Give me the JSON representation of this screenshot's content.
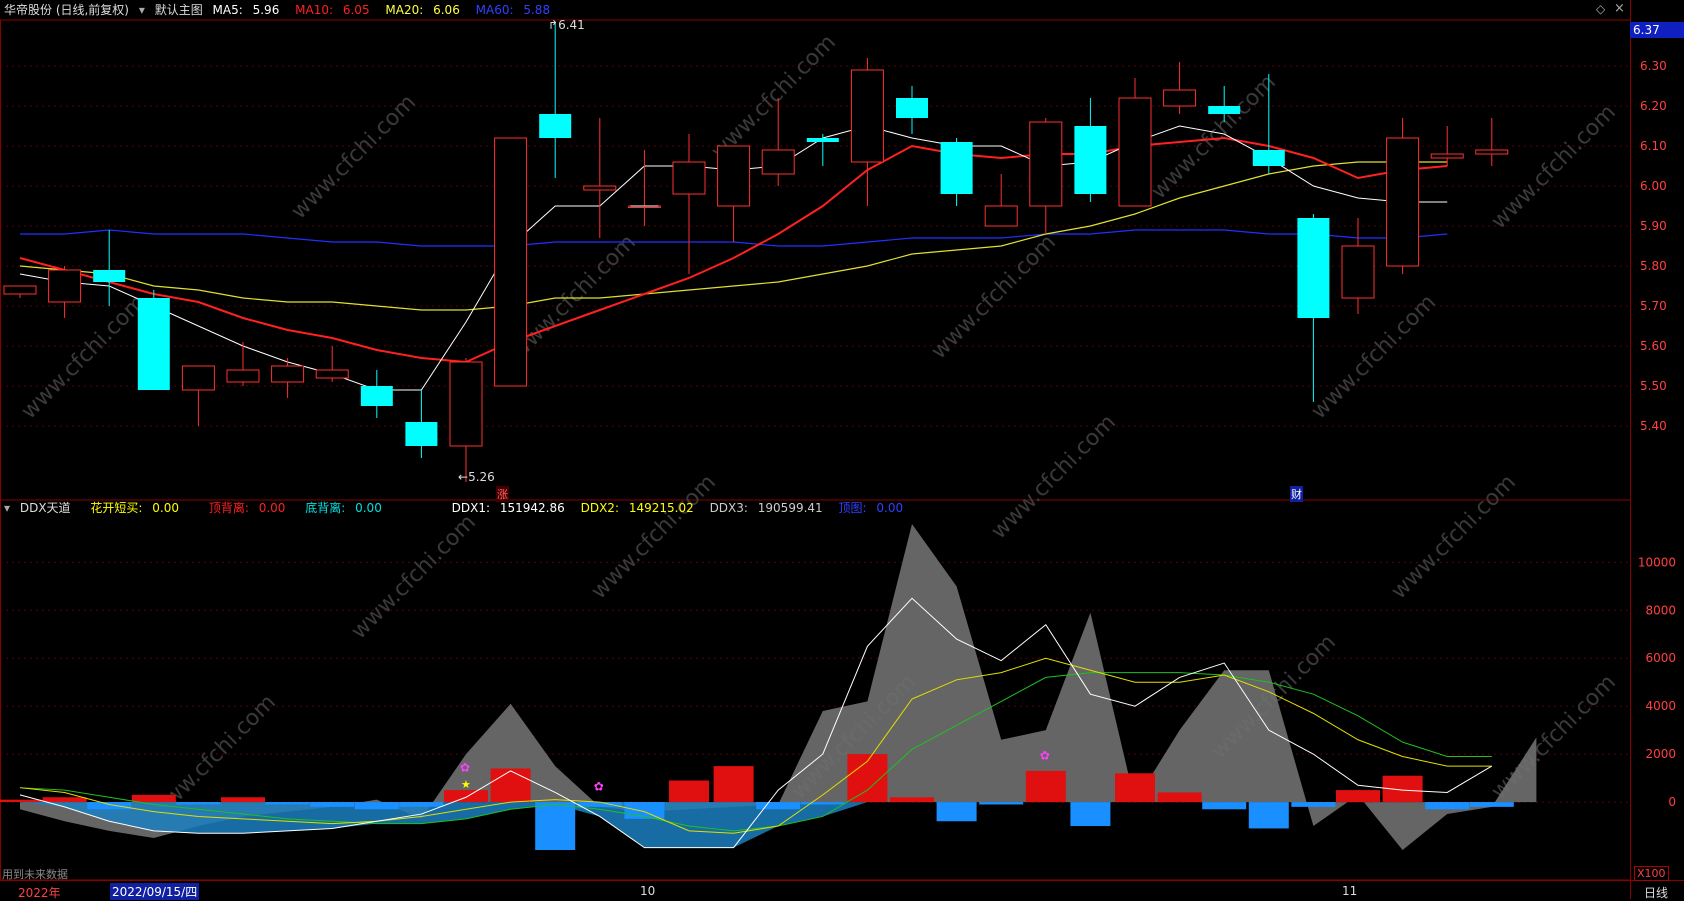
{
  "header": {
    "stock": "华帝股份 (日线,前复权)",
    "main_chart_label": "默认主图",
    "ma5": {
      "label": "MA5:",
      "value": "5.96",
      "color": "#ffffff"
    },
    "ma10": {
      "label": "MA10:",
      "value": "6.05",
      "color": "#ff2020"
    },
    "ma20": {
      "label": "MA20:",
      "value": "6.06",
      "color": "#ffff40"
    },
    "ma60": {
      "label": "MA60:",
      "value": "5.88",
      "color": "#2030ff"
    },
    "current_price": "6.37"
  },
  "sub_header": {
    "indicator": "DDX天道",
    "f1": {
      "label": "花开短买:",
      "value": "0.00",
      "color": "#ffff00"
    },
    "f2": {
      "label": "顶背离:",
      "value": "0.00",
      "color": "#ff2020"
    },
    "f3": {
      "label": "底背离:",
      "value": "0.00",
      "color": "#00ffff"
    },
    "ddx1": {
      "label": "DDX1:",
      "value": "151942.86",
      "color": "#ffffff"
    },
    "ddx2": {
      "label": "DDX2:",
      "value": "149215.02",
      "color": "#ffff00"
    },
    "ddx3": {
      "label": "DDX3:",
      "value": "190599.41",
      "color": "#cccccc"
    },
    "f7": {
      "label": "顶图:",
      "value": "0.00",
      "color": "#3040ff"
    }
  },
  "price_axis": [
    "6.30",
    "6.20",
    "6.10",
    "6.00",
    "5.90",
    "5.80",
    "5.70",
    "5.60",
    "5.50",
    "5.40"
  ],
  "ddx_axis": [
    "10000",
    "8000",
    "6000",
    "4000",
    "2000",
    "0"
  ],
  "annotations": {
    "high": "6.41",
    "low": "5.26",
    "tag_zhang": "涨",
    "tag_cai": "财",
    "x100": "X100",
    "future_data": "用到未来数据"
  },
  "time_axis": {
    "year": "2022年",
    "cursor_date": "2022/09/15/四",
    "m10": "10",
    "m11": "11",
    "period": "日线"
  },
  "watermark": "www.cfchi.com",
  "chart_data": {
    "type": "candlestick",
    "candles": [
      {
        "o": 5.73,
        "h": 5.75,
        "l": 5.72,
        "c": 5.75
      },
      {
        "o": 5.71,
        "h": 5.8,
        "l": 5.67,
        "c": 5.79
      },
      {
        "o": 5.79,
        "h": 5.89,
        "l": 5.7,
        "c": 5.76
      },
      {
        "o": 5.72,
        "h": 5.74,
        "l": 5.49,
        "c": 5.49
      },
      {
        "o": 5.49,
        "h": 5.55,
        "l": 5.4,
        "c": 5.55
      },
      {
        "o": 5.51,
        "h": 5.61,
        "l": 5.5,
        "c": 5.54
      },
      {
        "o": 5.51,
        "h": 5.57,
        "l": 5.47,
        "c": 5.55
      },
      {
        "o": 5.52,
        "h": 5.6,
        "l": 5.51,
        "c": 5.54
      },
      {
        "o": 5.5,
        "h": 5.54,
        "l": 5.42,
        "c": 5.45
      },
      {
        "o": 5.41,
        "h": 5.49,
        "l": 5.32,
        "c": 5.35
      },
      {
        "o": 5.35,
        "h": 5.57,
        "l": 5.26,
        "c": 5.56
      },
      {
        "o": 5.5,
        "h": 6.12,
        "l": 5.5,
        "c": 6.12
      },
      {
        "o": 6.18,
        "h": 6.41,
        "l": 6.02,
        "c": 6.12
      },
      {
        "o": 5.99,
        "h": 6.17,
        "l": 5.87,
        "c": 6.0
      },
      {
        "o": 5.95,
        "h": 6.09,
        "l": 5.9,
        "c": 5.95
      },
      {
        "o": 5.98,
        "h": 6.13,
        "l": 5.78,
        "c": 6.06
      },
      {
        "o": 5.95,
        "h": 6.1,
        "l": 5.86,
        "c": 6.1
      },
      {
        "o": 6.03,
        "h": 6.22,
        "l": 6.0,
        "c": 6.09
      },
      {
        "o": 6.12,
        "h": 6.13,
        "l": 6.05,
        "c": 6.11
      },
      {
        "o": 6.06,
        "h": 6.32,
        "l": 5.95,
        "c": 6.29
      },
      {
        "o": 6.22,
        "h": 6.25,
        "l": 6.13,
        "c": 6.17
      },
      {
        "o": 6.11,
        "h": 6.12,
        "l": 5.95,
        "c": 5.98
      },
      {
        "o": 5.9,
        "h": 6.03,
        "l": 5.9,
        "c": 5.95
      },
      {
        "o": 5.95,
        "h": 6.17,
        "l": 5.88,
        "c": 6.16
      },
      {
        "o": 6.15,
        "h": 6.22,
        "l": 5.96,
        "c": 5.98
      },
      {
        "o": 5.95,
        "h": 6.27,
        "l": 5.95,
        "c": 6.22
      },
      {
        "o": 6.2,
        "h": 6.31,
        "l": 6.18,
        "c": 6.24
      },
      {
        "o": 6.2,
        "h": 6.25,
        "l": 6.16,
        "c": 6.18
      },
      {
        "o": 6.09,
        "h": 6.28,
        "l": 6.03,
        "c": 6.05
      },
      {
        "o": 5.92,
        "h": 5.93,
        "l": 5.46,
        "c": 5.67
      },
      {
        "o": 5.72,
        "h": 5.92,
        "l": 5.68,
        "c": 5.85
      },
      {
        "o": 5.8,
        "h": 6.17,
        "l": 5.78,
        "c": 6.12
      },
      {
        "o": 6.07,
        "h": 6.15,
        "l": 6.05,
        "c": 6.08
      },
      {
        "o": 6.08,
        "h": 6.17,
        "l": 6.05,
        "c": 6.09
      }
    ],
    "ma5": [
      5.78,
      5.76,
      5.75,
      5.7,
      5.65,
      5.6,
      5.56,
      5.53,
      5.49,
      5.49,
      5.66,
      5.85,
      5.95,
      5.95,
      6.05,
      6.05,
      6.04,
      6.05,
      6.12,
      6.15,
      6.12,
      6.1,
      6.1,
      6.05,
      6.06,
      6.11,
      6.15,
      6.13,
      6.07,
      6.0,
      5.97,
      5.96,
      5.96
    ],
    "ma10": [
      5.82,
      5.79,
      5.76,
      5.73,
      5.71,
      5.67,
      5.64,
      5.62,
      5.59,
      5.57,
      5.56,
      5.61,
      5.65,
      5.69,
      5.73,
      5.77,
      5.82,
      5.88,
      5.95,
      6.04,
      6.1,
      6.08,
      6.07,
      6.08,
      6.08,
      6.1,
      6.11,
      6.12,
      6.1,
      6.07,
      6.02,
      6.04,
      6.05
    ],
    "ma20": [
      5.8,
      5.79,
      5.78,
      5.75,
      5.74,
      5.72,
      5.71,
      5.71,
      5.7,
      5.69,
      5.69,
      5.7,
      5.72,
      5.72,
      5.73,
      5.74,
      5.75,
      5.76,
      5.78,
      5.8,
      5.83,
      5.84,
      5.85,
      5.88,
      5.9,
      5.93,
      5.97,
      6.0,
      6.03,
      6.05,
      6.06,
      6.06,
      6.06
    ],
    "ma60": [
      5.88,
      5.88,
      5.89,
      5.88,
      5.88,
      5.88,
      5.87,
      5.86,
      5.86,
      5.85,
      5.85,
      5.85,
      5.86,
      5.86,
      5.86,
      5.86,
      5.86,
      5.85,
      5.85,
      5.86,
      5.87,
      5.87,
      5.87,
      5.88,
      5.88,
      5.89,
      5.89,
      5.89,
      5.88,
      5.88,
      5.87,
      5.87,
      5.88
    ],
    "ddx_gray": [
      -300,
      -800,
      -1200,
      -1500,
      -1000,
      -600,
      -400,
      -200,
      100,
      -700,
      2000,
      4100,
      1500,
      -200,
      -400,
      -300,
      -200,
      -100,
      3800,
      4200,
      11600,
      9000,
      2600,
      3000,
      7900,
      0,
      3000,
      5500,
      5500,
      -1000,
      300,
      -2000,
      -500,
      -200,
      2700
    ],
    "ddx_white": [
      300,
      -200,
      -800,
      -1200,
      -1300,
      -1300,
      -1200,
      -1100,
      -800,
      -500,
      200,
      1300,
      400,
      -600,
      -1900,
      -1900,
      -1900,
      500,
      2000,
      6500,
      8500,
      6800,
      5900,
      7400,
      4500,
      4000,
      5200,
      5800,
      3000,
      2000,
      700,
      500,
      400,
      1500
    ],
    "ddx_yellow": [
      600,
      400,
      -100,
      -400,
      -600,
      -700,
      -800,
      -900,
      -800,
      -600,
      -300,
      0,
      100,
      0,
      -400,
      -1200,
      -1300,
      -1000,
      300,
      1700,
      4300,
      5100,
      5400,
      6000,
      5500,
      5000,
      5000,
      5300,
      4600,
      3700,
      2600,
      1900,
      1500,
      1500
    ],
    "ddx_green": [
      600,
      500,
      200,
      -100,
      -300,
      -500,
      -700,
      -800,
      -900,
      -900,
      -700,
      -300,
      -100,
      -300,
      -600,
      -1000,
      -1200,
      -1000,
      -600,
      500,
      2200,
      3200,
      4200,
      5200,
      5400,
      5400,
      5400,
      5300,
      5000,
      4500,
      3600,
      2500,
      1900,
      1900
    ],
    "ddx_bars": [
      100,
      200,
      -300,
      300,
      -100,
      200,
      -100,
      -200,
      -300,
      -200,
      500,
      1400,
      -2000,
      -200,
      -700,
      900,
      1500,
      -300,
      -100,
      2000,
      200,
      -800,
      -100,
      1300,
      -1000,
      1200,
      400,
      -300,
      -1100,
      -200,
      500,
      1100,
      -300,
      -200
    ]
  }
}
